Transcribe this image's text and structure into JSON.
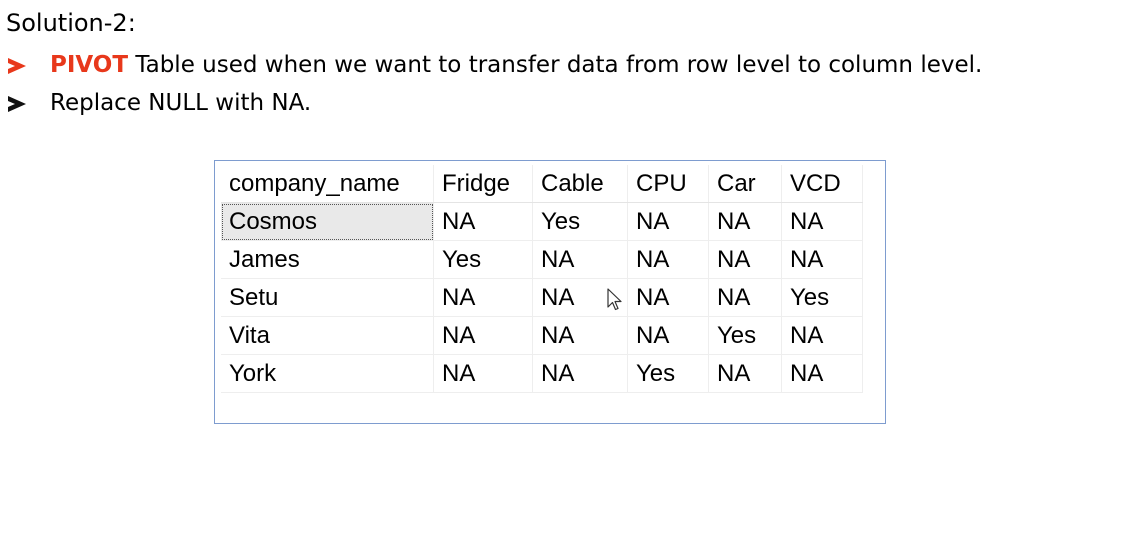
{
  "slide": {
    "heading": "Solution-2:",
    "bullets": [
      {
        "keyword": "PIVOT",
        "text": " Table used when we want to transfer data from row level to column level."
      },
      {
        "keyword": "",
        "text": "Replace NULL with NA."
      }
    ]
  },
  "grid": {
    "headers": [
      "company_name",
      "Fridge",
      "Cable",
      "CPU",
      "Car",
      "VCD"
    ],
    "rows": [
      [
        "Cosmos",
        "NA",
        "Yes",
        "NA",
        "NA",
        "NA"
      ],
      [
        "James",
        "Yes",
        "NA",
        "NA",
        "NA",
        "NA"
      ],
      [
        "Setu",
        "NA",
        "NA",
        "NA",
        "NA",
        "Yes"
      ],
      [
        "Vita",
        "NA",
        "NA",
        "NA",
        "Yes",
        "NA"
      ],
      [
        "York",
        "NA",
        "NA",
        "Yes",
        "NA",
        "NA"
      ]
    ]
  },
  "icons": {
    "bullet_1": "arrow-bullet-icon",
    "bullet_2": "arrow-bullet-icon",
    "pointer": "mouse-pointer-icon"
  },
  "colors": {
    "keyword": "#e8381b",
    "grid_border": "#7e9ccf",
    "selected_cell": "#e9e9e9"
  }
}
